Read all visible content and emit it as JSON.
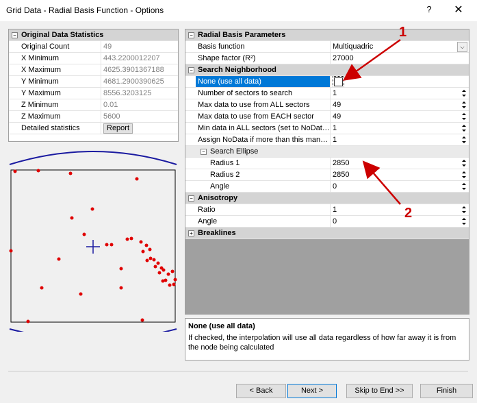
{
  "window": {
    "title": "Grid Data - Radial Basis Function - Options",
    "help": "?",
    "close": "✕"
  },
  "stats": {
    "header": "Original Data Statistics",
    "rows": [
      {
        "label": "Original Count",
        "value": "49"
      },
      {
        "label": "X Minimum",
        "value": "443.2200012207"
      },
      {
        "label": "X Maximum",
        "value": "4625.3901367188"
      },
      {
        "label": "Y Minimum",
        "value": "4681.2900390625"
      },
      {
        "label": "Y Maximum",
        "value": "8556.3203125"
      },
      {
        "label": "Z Minimum",
        "value": "0.01"
      },
      {
        "label": "Z Maximum",
        "value": "5600"
      }
    ],
    "detailed_label": "Detailed statistics",
    "report_button": "Report"
  },
  "props": {
    "rbp_header": "Radial Basis Parameters",
    "basis_label": "Basis function",
    "basis_value": "Multiquadric",
    "shape_label": "Shape factor (R²)",
    "shape_value": "27000",
    "search_header": "Search Neighborhood",
    "none_label": "None (use all data)",
    "sectors_label": "Number of sectors to search",
    "sectors_value": "1",
    "maxall_label": "Max data to use from ALL sectors",
    "maxall_value": "49",
    "maxeach_label": "Max data to use from EACH sector",
    "maxeach_value": "49",
    "minall_label": "Min data in ALL sectors (set to NoDat…",
    "minall_value": "1",
    "assign_label": "Assign NoData if more than this man…",
    "assign_value": "1",
    "ellipse_header": "Search Ellipse",
    "radius1_label": "Radius 1",
    "radius1_value": "2850",
    "radius2_label": "Radius 2",
    "radius2_value": "2850",
    "angle_label": "Angle",
    "angle_value": "0",
    "aniso_header": "Anisotropy",
    "ratio_label": "Ratio",
    "ratio_value": "1",
    "aniso_angle_label": "Angle",
    "aniso_angle_value": "0",
    "breaklines_header": "Breaklines"
  },
  "description": {
    "title": "None (use all data)",
    "text": "If checked, the interpolation will use all data regardless of how far away it is from the node being calculated"
  },
  "callouts": {
    "one": "1",
    "two": "2"
  },
  "buttons": {
    "back": "< Back",
    "next": "Next >",
    "skip": "Skip to End >>",
    "finish": "Finish"
  },
  "colors": {
    "selection": "#0078d7",
    "data_points": "#e00000",
    "boundary": "#1a1aa0",
    "callout": "#cc0000"
  }
}
